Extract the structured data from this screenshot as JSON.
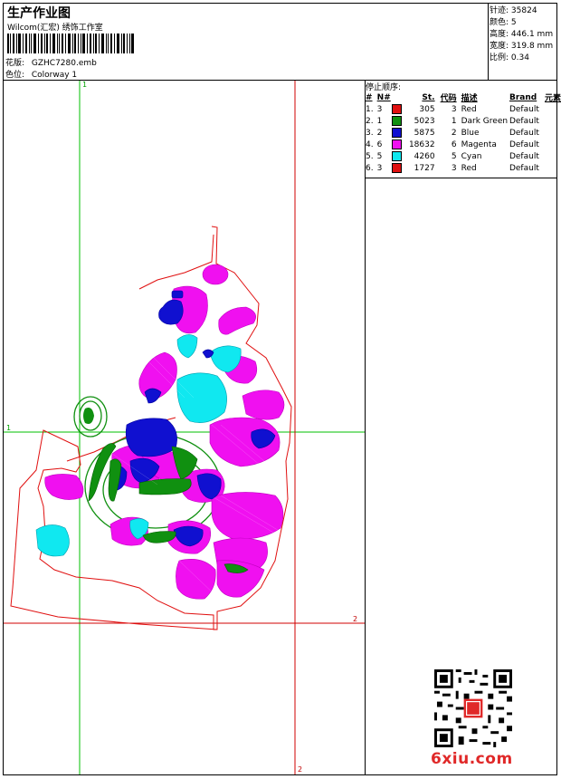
{
  "header": {
    "title": "生产作业图",
    "company": "Wilcom(汇宏) 绣饰工作室",
    "design_label": "花版:",
    "design_value": "GZHC7280.emb",
    "colorway_label": "色位:",
    "colorway_value": "Colorway 1"
  },
  "stats": [
    {
      "label": "针迹:",
      "value": "35824"
    },
    {
      "label": "颜色:",
      "value": "5"
    },
    {
      "label": "高度:",
      "value": "446.1 mm"
    },
    {
      "label": "宽度:",
      "value": "319.8 mm"
    },
    {
      "label": "比例:",
      "value": "0.34"
    }
  ],
  "stop_sequence": {
    "title": "停止顺序:",
    "columns": [
      "#",
      "N#",
      "St.",
      "代码",
      "描述",
      "Brand",
      "元素"
    ],
    "rows": [
      {
        "idx": "1.",
        "n": "3",
        "color": "#e01010",
        "st": "305",
        "code": "3",
        "desc": "Red",
        "brand": "Default"
      },
      {
        "idx": "2.",
        "n": "1",
        "color": "#109010",
        "st": "5023",
        "code": "1",
        "desc": "Dark Green",
        "brand": "Default"
      },
      {
        "idx": "3.",
        "n": "2",
        "color": "#1010d0",
        "st": "5875",
        "code": "2",
        "desc": "Blue",
        "brand": "Default"
      },
      {
        "idx": "4.",
        "n": "6",
        "color": "#f010f0",
        "st": "18632",
        "code": "6",
        "desc": "Magenta",
        "brand": "Default"
      },
      {
        "idx": "5.",
        "n": "5",
        "color": "#10e8f0",
        "st": "4260",
        "code": "5",
        "desc": "Cyan",
        "brand": "Default"
      },
      {
        "idx": "6.",
        "n": "3",
        "color": "#e01010",
        "st": "1727",
        "code": "3",
        "desc": "Red",
        "brand": "Default"
      }
    ]
  },
  "guides": {
    "v1_label": "1",
    "h1_label": "1",
    "h2_label": "2",
    "v2_label": "2"
  },
  "watermark": "6xiu.com",
  "colors": {
    "magenta": "#f010f0",
    "cyan": "#10e8f0",
    "blue": "#1010d0",
    "green": "#109010",
    "red": "#e01010",
    "guide_green": "#00c000",
    "guide_red": "#d00000"
  }
}
